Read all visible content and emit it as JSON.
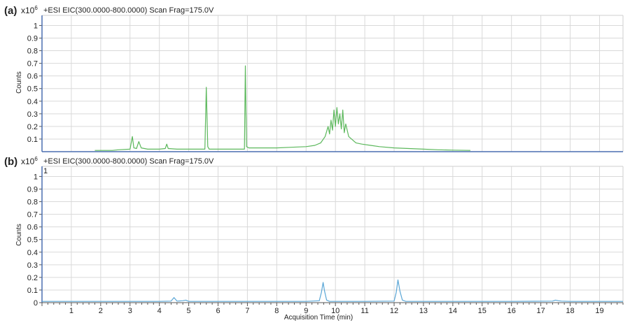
{
  "figure": {
    "panel_a_label": "(a)",
    "panel_b_label": "(b)",
    "multiplier_base": "x10",
    "multiplier_exp": "6",
    "panel_b_marker": "1",
    "colors": {
      "panel_a_trace": "#5cb85c",
      "panel_b_trace": "#5aa6d6",
      "frame": "#4a6fb0",
      "grid": "#d9d9d9"
    }
  },
  "chart_data": [
    {
      "type": "line",
      "title": "+ESI EIC(300.0000-800.0000) Scan Frag=175.0V",
      "ylabel": "Counts",
      "xlabel": "",
      "xlim": [
        0,
        19.8
      ],
      "ylim": [
        0,
        1.08
      ],
      "grid": true,
      "yticks": [
        "0.1",
        "0.2",
        "0.3",
        "0.4",
        "0.5",
        "0.6",
        "0.7",
        "0.8",
        "0.9",
        "1"
      ],
      "baseline": 0.0,
      "series": [
        {
          "color": "#5cb85c",
          "points": [
            [
              1.8,
              0.01
            ],
            [
              2.4,
              0.01
            ],
            [
              2.6,
              0.015
            ],
            [
              3.0,
              0.02
            ],
            [
              3.08,
              0.12
            ],
            [
              3.13,
              0.03
            ],
            [
              3.22,
              0.025
            ],
            [
              3.3,
              0.08
            ],
            [
              3.38,
              0.03
            ],
            [
              3.6,
              0.02
            ],
            [
              4.0,
              0.02
            ],
            [
              4.2,
              0.025
            ],
            [
              4.25,
              0.06
            ],
            [
              4.3,
              0.025
            ],
            [
              4.6,
              0.02
            ],
            [
              5.0,
              0.02
            ],
            [
              5.3,
              0.02
            ],
            [
              5.55,
              0.02
            ],
            [
              5.6,
              0.51
            ],
            [
              5.65,
              0.04
            ],
            [
              5.7,
              0.02
            ],
            [
              6.0,
              0.02
            ],
            [
              6.3,
              0.02
            ],
            [
              6.6,
              0.02
            ],
            [
              6.9,
              0.02
            ],
            [
              6.93,
              0.68
            ],
            [
              6.97,
              0.04
            ],
            [
              7.05,
              0.03
            ],
            [
              7.5,
              0.03
            ],
            [
              8.0,
              0.03
            ],
            [
              8.5,
              0.035
            ],
            [
              9.0,
              0.04
            ],
            [
              9.3,
              0.05
            ],
            [
              9.5,
              0.07
            ],
            [
              9.65,
              0.12
            ],
            [
              9.75,
              0.2
            ],
            [
              9.8,
              0.14
            ],
            [
              9.85,
              0.25
            ],
            [
              9.9,
              0.17
            ],
            [
              9.95,
              0.33
            ],
            [
              10.0,
              0.2
            ],
            [
              10.05,
              0.35
            ],
            [
              10.1,
              0.22
            ],
            [
              10.15,
              0.3
            ],
            [
              10.2,
              0.18
            ],
            [
              10.25,
              0.33
            ],
            [
              10.3,
              0.15
            ],
            [
              10.35,
              0.22
            ],
            [
              10.45,
              0.12
            ],
            [
              10.55,
              0.1
            ],
            [
              10.7,
              0.07
            ],
            [
              10.9,
              0.06
            ],
            [
              11.2,
              0.05
            ],
            [
              11.5,
              0.04
            ],
            [
              12.0,
              0.03
            ],
            [
              12.5,
              0.025
            ],
            [
              13.0,
              0.02
            ],
            [
              13.5,
              0.015
            ],
            [
              14.0,
              0.012
            ],
            [
              14.6,
              0.01
            ]
          ]
        }
      ]
    },
    {
      "type": "line",
      "title": "+ESI EIC(300.0000-800.0000) Scan Frag=175.0V",
      "ylabel": "Counts",
      "xlabel": "Acquisition Time (min)",
      "xlim": [
        0,
        19.8
      ],
      "ylim": [
        0,
        1.08
      ],
      "grid": true,
      "yticks": [
        "0",
        "0.1",
        "0.2",
        "0.3",
        "0.4",
        "0.5",
        "0.6",
        "0.7",
        "0.8",
        "0.9",
        "1"
      ],
      "xticks": [
        "1",
        "2",
        "3",
        "4",
        "5",
        "6",
        "7",
        "8",
        "9",
        "10",
        "11",
        "12",
        "13",
        "14",
        "15",
        "16",
        "17",
        "18",
        "19"
      ],
      "series": [
        {
          "color": "#5aa6d6",
          "points": [
            [
              0.0,
              0.01
            ],
            [
              1.0,
              0.01
            ],
            [
              2.0,
              0.01
            ],
            [
              3.0,
              0.01
            ],
            [
              4.0,
              0.01
            ],
            [
              4.4,
              0.012
            ],
            [
              4.5,
              0.04
            ],
            [
              4.6,
              0.012
            ],
            [
              4.8,
              0.015
            ],
            [
              4.9,
              0.02
            ],
            [
              5.0,
              0.01
            ],
            [
              6.0,
              0.01
            ],
            [
              7.0,
              0.01
            ],
            [
              8.0,
              0.01
            ],
            [
              9.0,
              0.01
            ],
            [
              9.45,
              0.015
            ],
            [
              9.52,
              0.08
            ],
            [
              9.58,
              0.16
            ],
            [
              9.63,
              0.09
            ],
            [
              9.7,
              0.02
            ],
            [
              9.8,
              0.01
            ],
            [
              11.0,
              0.01
            ],
            [
              12.0,
              0.012
            ],
            [
              12.07,
              0.08
            ],
            [
              12.13,
              0.18
            ],
            [
              12.2,
              0.09
            ],
            [
              12.28,
              0.02
            ],
            [
              12.4,
              0.01
            ],
            [
              14.0,
              0.01
            ],
            [
              16.0,
              0.01
            ],
            [
              17.4,
              0.012
            ],
            [
              17.5,
              0.02
            ],
            [
              17.6,
              0.015
            ],
            [
              17.7,
              0.012
            ],
            [
              18.0,
              0.01
            ],
            [
              19.8,
              0.01
            ]
          ]
        }
      ]
    }
  ]
}
